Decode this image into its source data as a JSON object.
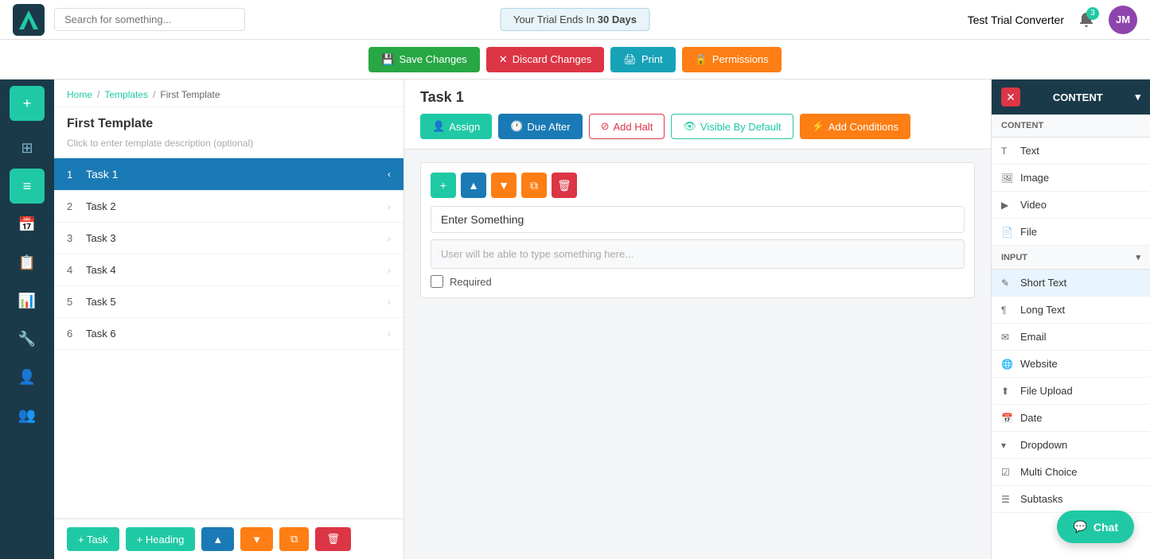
{
  "topbar": {
    "search_placeholder": "Search for something...",
    "trial_text": "Your Trial Ends In ",
    "trial_days": "30 Days",
    "account_name": "Test Trial Converter",
    "notif_count": "3",
    "avatar_initials": "JM"
  },
  "actionbar": {
    "save_label": "Save Changes",
    "discard_label": "Discard Changes",
    "print_label": "Print",
    "permissions_label": "Permissions"
  },
  "breadcrumb": {
    "home": "Home",
    "templates": "Templates",
    "current": "First Template"
  },
  "template": {
    "title": "First Template",
    "description": "Click to enter template description (optional)"
  },
  "tasks": [
    {
      "num": "1",
      "name": "Task 1",
      "active": true
    },
    {
      "num": "2",
      "name": "Task 2",
      "active": false
    },
    {
      "num": "3",
      "name": "Task 3",
      "active": false
    },
    {
      "num": "4",
      "name": "Task 4",
      "active": false
    },
    {
      "num": "5",
      "name": "Task 5",
      "active": false
    },
    {
      "num": "6",
      "name": "Task 6",
      "active": false
    }
  ],
  "task_actions": {
    "assign": "Assign",
    "due_after": "Due After",
    "add_halt": "Add Halt",
    "visible_by_default": "Visible By Default",
    "add_conditions": "Add Conditions"
  },
  "task_title": "Task 1",
  "field": {
    "label_placeholder": "Enter Something",
    "input_placeholder": "User will be able to type something here...",
    "required_label": "Required"
  },
  "footer_buttons": {
    "task": "+ Task",
    "heading": "+ Heading"
  },
  "right_panel": {
    "title": "CONTENT",
    "sections": [
      {
        "header": "CONTENT",
        "items": [
          {
            "icon": "T",
            "label": "Text"
          },
          {
            "icon": "🖼",
            "label": "Image"
          },
          {
            "icon": "▶",
            "label": "Video"
          },
          {
            "icon": "📄",
            "label": "File"
          }
        ]
      },
      {
        "header": "INPUT",
        "items": [
          {
            "icon": "✎",
            "label": "Short Text"
          },
          {
            "icon": "¶",
            "label": "Long Text"
          },
          {
            "icon": "✉",
            "label": "Email"
          },
          {
            "icon": "🌐",
            "label": "Website"
          },
          {
            "icon": "⬆",
            "label": "File Upload"
          },
          {
            "icon": "📅",
            "label": "Date"
          },
          {
            "icon": "▾",
            "label": "Dropdown"
          },
          {
            "icon": "☑",
            "label": "Multi Choice"
          },
          {
            "icon": "☰",
            "label": "Subtasks"
          }
        ]
      }
    ]
  },
  "chat": {
    "label": "Chat"
  },
  "nav": {
    "items": [
      {
        "icon": "+",
        "name": "add",
        "active": false
      },
      {
        "icon": "⊞",
        "name": "dashboard",
        "active": false
      },
      {
        "icon": "≡",
        "name": "tasks",
        "active": true
      },
      {
        "icon": "📅",
        "name": "calendar",
        "active": false
      },
      {
        "icon": "📋",
        "name": "documents",
        "active": false
      },
      {
        "icon": "📊",
        "name": "reports",
        "active": false
      },
      {
        "icon": "🔧",
        "name": "settings",
        "active": false
      },
      {
        "icon": "👤",
        "name": "users",
        "active": false
      },
      {
        "icon": "👥",
        "name": "teams",
        "active": false
      }
    ]
  }
}
